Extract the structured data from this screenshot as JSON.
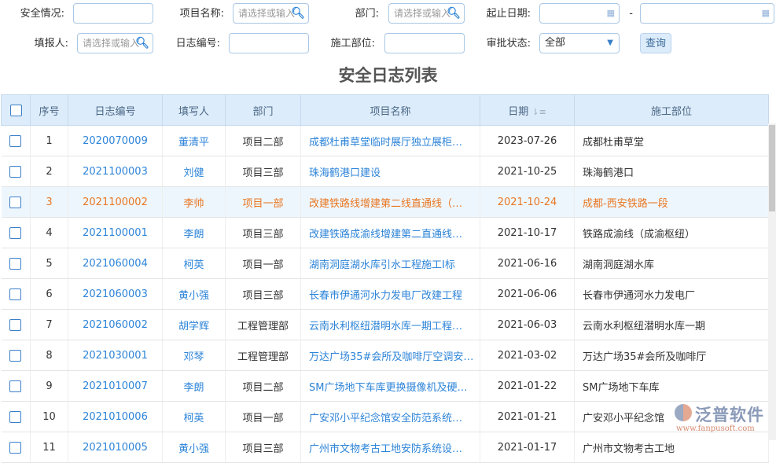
{
  "filters": {
    "safety_label": "安全情况:",
    "safety_value": "",
    "project_label": "项目名称:",
    "project_placeholder": "请选择或输入",
    "dept_label": "部门:",
    "dept_placeholder": "请选择或输入",
    "date_label": "起止日期:",
    "date_sep": "-",
    "reporter_label": "填报人:",
    "reporter_placeholder": "请选择或输入",
    "log_no_label": "日志编号:",
    "site_label": "施工部位:",
    "status_label": "审批状态:",
    "status_value": "全部",
    "query_label": "查询"
  },
  "title": "安全日志列表",
  "columns": [
    "序号",
    "日志编号",
    "填写人",
    "部门",
    "项目名称",
    "日期",
    "施工部位"
  ],
  "rows": [
    {
      "no": "1",
      "log": "2020070009",
      "person": "董清平",
      "dept": "项目二部",
      "project": "成都杜甫草堂临时展厅独立展柜…",
      "date": "2023-07-26",
      "site": "成都杜甫草堂"
    },
    {
      "no": "2",
      "log": "2021100003",
      "person": "刘健",
      "dept": "项目三部",
      "project": "珠海鹤港口建设",
      "date": "2021-10-25",
      "site": "珠海鹤港口"
    },
    {
      "no": "3",
      "log": "2021100002",
      "person": "李帅",
      "dept": "项目一部",
      "project": "改建铁路线增建第二线直通线（…",
      "date": "2021-10-24",
      "site": "成都-西安铁路一段"
    },
    {
      "no": "4",
      "log": "2021100001",
      "person": "李朗",
      "dept": "项目三部",
      "project": "改建铁路成渝线增建第二直通线…",
      "date": "2021-10-17",
      "site": "铁路成渝线（成渝枢纽）"
    },
    {
      "no": "5",
      "log": "2021060004",
      "person": "柯英",
      "dept": "项目一部",
      "project": "湖南洞庭湖水库引水工程施工I标",
      "date": "2021-06-16",
      "site": "湖南洞庭湖水库"
    },
    {
      "no": "6",
      "log": "2021060003",
      "person": "黄小强",
      "dept": "项目三部",
      "project": "长春市伊通河水力发电厂改建工程",
      "date": "2021-06-06",
      "site": "长春市伊通河水力发电厂"
    },
    {
      "no": "7",
      "log": "2021060002",
      "person": "胡学辉",
      "dept": "工程管理部",
      "project": "云南水利枢纽潜明水库一期工程…",
      "date": "2021-06-03",
      "site": "云南水利枢纽潜明水库一期"
    },
    {
      "no": "8",
      "log": "2021030001",
      "person": "邓琴",
      "dept": "工程管理部",
      "project": "万达广场35#会所及咖啡厅空调安…",
      "date": "2021-03-02",
      "site": "万达广场35#会所及咖啡厅"
    },
    {
      "no": "9",
      "log": "2021010007",
      "person": "李朗",
      "dept": "项目二部",
      "project": "SM广场地下车库更换摄像机及硬…",
      "date": "2021-01-22",
      "site": "SM广场地下车库"
    },
    {
      "no": "10",
      "log": "2021010006",
      "person": "柯英",
      "dept": "项目一部",
      "project": "广安邓小平纪念馆安全防范系统…",
      "date": "2021-01-21",
      "site": "广安邓小平纪念馆"
    },
    {
      "no": "11",
      "log": "2021010005",
      "person": "黄小强",
      "dept": "项目三部",
      "project": "广州市文物考古工地安防系统设…",
      "date": "2021-01-17",
      "site": "广州市文物考古工地"
    }
  ],
  "selected_row": 3,
  "watermark": {
    "brand": "泛普软件",
    "url": "www.fanpusoft.com"
  },
  "colors": {
    "accent": "#2d84d8",
    "selected": "#e87722",
    "header_bg": "#ddecfb"
  }
}
